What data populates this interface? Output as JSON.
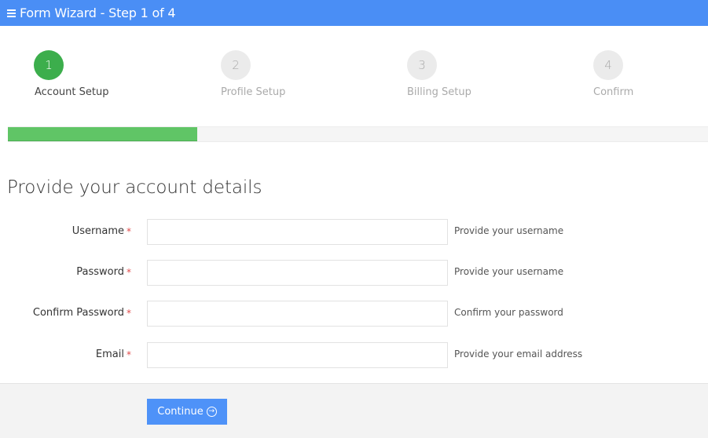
{
  "header": {
    "title": "Form Wizard - Step 1 of 4",
    "menu_icon": "hamburger-menu-icon"
  },
  "steps": [
    {
      "number": "1",
      "label": "Account Setup",
      "active": true
    },
    {
      "number": "2",
      "label": "Profile Setup",
      "active": false
    },
    {
      "number": "3",
      "label": "Billing Setup",
      "active": false
    },
    {
      "number": "4",
      "label": "Confirm",
      "active": false
    }
  ],
  "progress": {
    "percent": 27,
    "fill_color": "#60c566"
  },
  "form": {
    "title": "Provide your account details",
    "required_marker": "*",
    "fields": [
      {
        "label": "Username",
        "value": "",
        "help": "Provide your username"
      },
      {
        "label": "Password",
        "value": "",
        "help": "Provide your username"
      },
      {
        "label": "Confirm Password",
        "value": "",
        "help": "Confirm your password"
      },
      {
        "label": "Email",
        "value": "",
        "help": "Provide your email address"
      }
    ]
  },
  "footer": {
    "continue_label": "Continue",
    "continue_icon": "arrow-circle-right-icon",
    "continue_icon_glyph": "→"
  },
  "colors": {
    "header": "#4a8ef5",
    "active_step": "#3cae4c",
    "button": "#4e92f8",
    "required": "#e04b4b"
  }
}
